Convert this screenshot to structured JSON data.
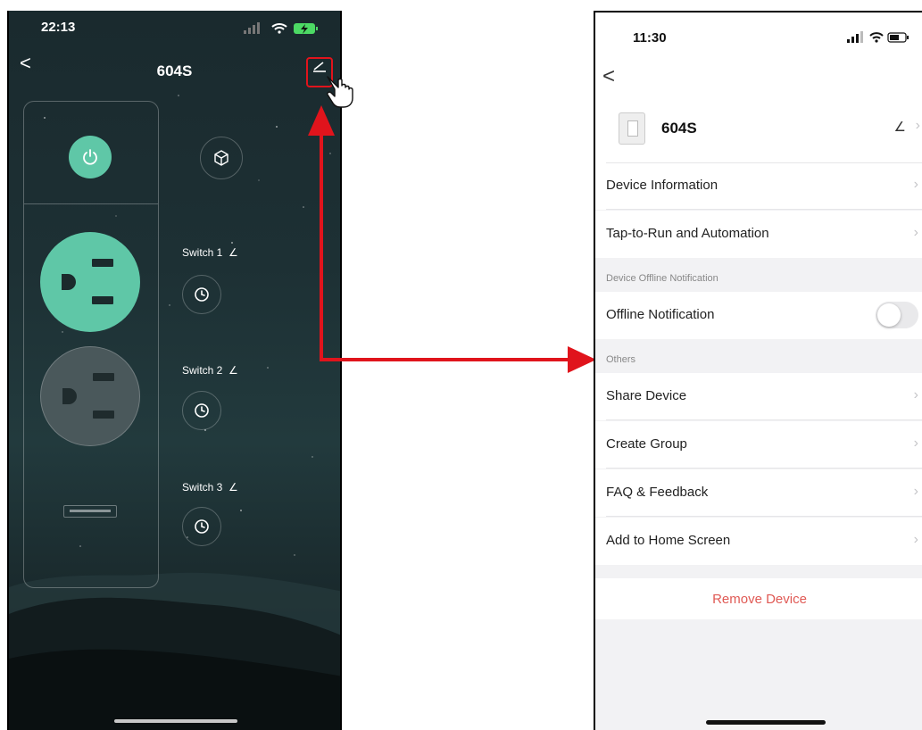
{
  "left_screen": {
    "time": "22:13",
    "title": "604S",
    "switches": [
      "Switch 1",
      "Switch 2",
      "Switch 3"
    ],
    "colors": {
      "accent": "#5fc7a7",
      "highlight": "#e0141c"
    }
  },
  "right_screen": {
    "time": "11:30",
    "device_name": "604S",
    "rows": {
      "device_information": "Device Information",
      "tap_to_run": "Tap-to-Run and Automation",
      "offline_section": "Device Offline Notification",
      "offline_notification": "Offline Notification",
      "others_section": "Others",
      "share_device": "Share Device",
      "create_group": "Create Group",
      "faq": "FAQ & Feedback",
      "add_home": "Add to Home Screen"
    },
    "offline_notification_enabled": false,
    "remove_label": "Remove Device",
    "colors": {
      "remove": "#e05a55"
    }
  }
}
